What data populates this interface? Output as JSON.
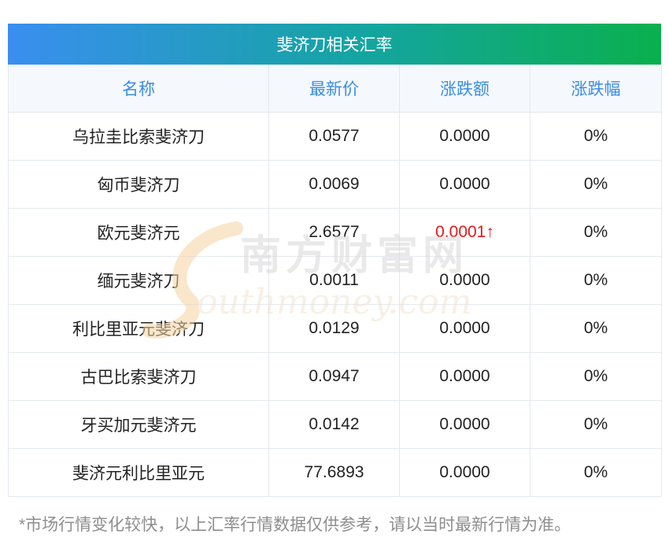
{
  "table": {
    "title": "斐济刀相关汇率",
    "headers": {
      "name": "名称",
      "price": "最新价",
      "change": "涨跌额",
      "change_pct": "涨跌幅"
    },
    "rows": [
      {
        "name": "乌拉圭比索斐济刀",
        "price": "0.0577",
        "change": "0.0000",
        "change_pct": "0%"
      },
      {
        "name": "匈币斐济刀",
        "price": "0.0069",
        "change": "0.0000",
        "change_pct": "0%"
      },
      {
        "name": "欧元斐济元",
        "price": "2.6577",
        "change": "0.0001↑",
        "change_pct": "0%"
      },
      {
        "name": "缅元斐济刀",
        "price": "0.0011",
        "change": "0.0000",
        "change_pct": "0%"
      },
      {
        "name": "利比里亚元斐济刀",
        "price": "0.0129",
        "change": "0.0000",
        "change_pct": "0%"
      },
      {
        "name": "古巴比索斐济刀",
        "price": "0.0947",
        "change": "0.0000",
        "change_pct": "0%"
      },
      {
        "name": "牙买加元斐济元",
        "price": "0.0142",
        "change": "0.0000",
        "change_pct": "0%"
      },
      {
        "name": "斐济元利比里亚元",
        "price": "77.6893",
        "change": "0.0000",
        "change_pct": "0%"
      }
    ]
  },
  "footnote": "*市场行情变化较快，以上汇率行情数据仅供参考，请以当时最新行情为准。",
  "watermark": {
    "cn": "南方财富网",
    "en": "outhmoney.com"
  },
  "colors": {
    "header_text": "#3a8ee0",
    "rise": "#e21a1a",
    "banner_start": "#3a8ef0",
    "banner_end": "#0ab04d"
  }
}
